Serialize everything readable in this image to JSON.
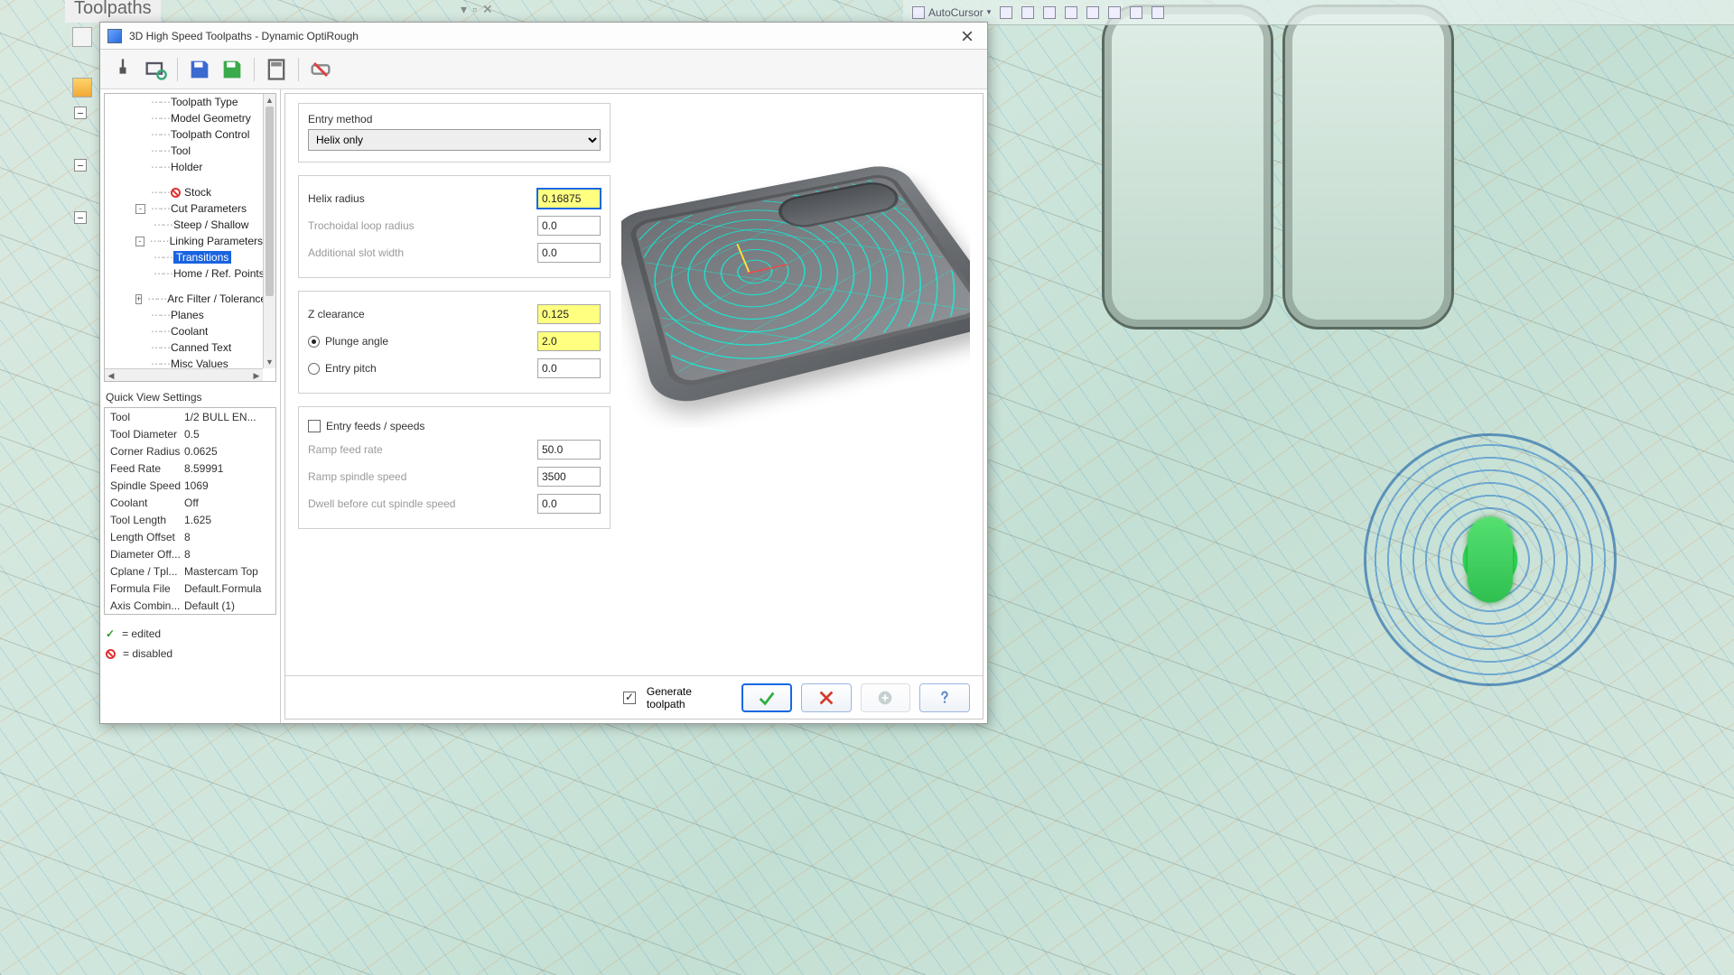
{
  "host": {
    "title": "Toolpaths"
  },
  "ribbon": {
    "autocursor": "AutoCursor"
  },
  "dialog": {
    "title": "3D High Speed Toolpaths - Dynamic OptiRough",
    "tree": [
      {
        "label": "Toolpath Type",
        "depth": 1
      },
      {
        "label": "Model Geometry",
        "depth": 1
      },
      {
        "label": "Toolpath Control",
        "depth": 1
      },
      {
        "label": "Tool",
        "depth": 1
      },
      {
        "label": "Holder",
        "depth": 1
      },
      {
        "label": "Stock",
        "depth": 1,
        "disabled": true,
        "gap": true
      },
      {
        "label": "Cut Parameters",
        "depth": 1,
        "exp": "-"
      },
      {
        "label": "Steep / Shallow",
        "depth": 2
      },
      {
        "label": "Linking Parameters",
        "depth": 1,
        "exp": "-"
      },
      {
        "label": "Transitions",
        "depth": 2,
        "selected": true
      },
      {
        "label": "Home / Ref. Points",
        "depth": 2
      },
      {
        "label": "Arc Filter / Tolerance",
        "depth": 1,
        "exp": "+",
        "gap": true
      },
      {
        "label": "Planes",
        "depth": 1
      },
      {
        "label": "Coolant",
        "depth": 1
      },
      {
        "label": "Canned Text",
        "depth": 1
      },
      {
        "label": "Misc Values",
        "depth": 1
      }
    ],
    "qvs_title": "Quick View Settings",
    "qvs": [
      {
        "k": "Tool",
        "v": "1/2 BULL EN..."
      },
      {
        "k": "Tool Diameter",
        "v": "0.5"
      },
      {
        "k": "Corner Radius",
        "v": "0.0625"
      },
      {
        "k": "Feed Rate",
        "v": "8.59991"
      },
      {
        "k": "Spindle Speed",
        "v": "1069"
      },
      {
        "k": "Coolant",
        "v": "Off"
      },
      {
        "k": "Tool Length",
        "v": "1.625"
      },
      {
        "k": "Length Offset",
        "v": "8"
      },
      {
        "k": "Diameter Off...",
        "v": "8"
      },
      {
        "k": "Cplane / Tpl...",
        "v": "Mastercam Top"
      },
      {
        "k": "Formula File",
        "v": "Default.Formula"
      },
      {
        "k": "Axis Combin...",
        "v": "Default (1)"
      }
    ],
    "legend": {
      "edited": "= edited",
      "disabled": "= disabled"
    },
    "form": {
      "entry_method_label": "Entry method",
      "entry_method_value": "Helix only",
      "helix_radius_label": "Helix radius",
      "helix_radius_value": "0.16875",
      "troch_label": "Trochoidal loop radius",
      "troch_value": "0.0",
      "slot_label": "Additional slot width",
      "slot_value": "0.0",
      "zclear_label": "Z clearance",
      "zclear_value": "0.125",
      "plunge_label": "Plunge angle",
      "plunge_value": "2.0",
      "pitch_label": "Entry pitch",
      "pitch_value": "0.0",
      "efs_label": "Entry feeds / speeds",
      "ramp_feed_label": "Ramp feed rate",
      "ramp_feed_value": "50.0",
      "ramp_ss_label": "Ramp spindle speed",
      "ramp_ss_value": "3500",
      "dwell_label": "Dwell before cut spindle speed",
      "dwell_value": "0.0"
    },
    "bottom": {
      "generate": "Generate toolpath"
    }
  }
}
